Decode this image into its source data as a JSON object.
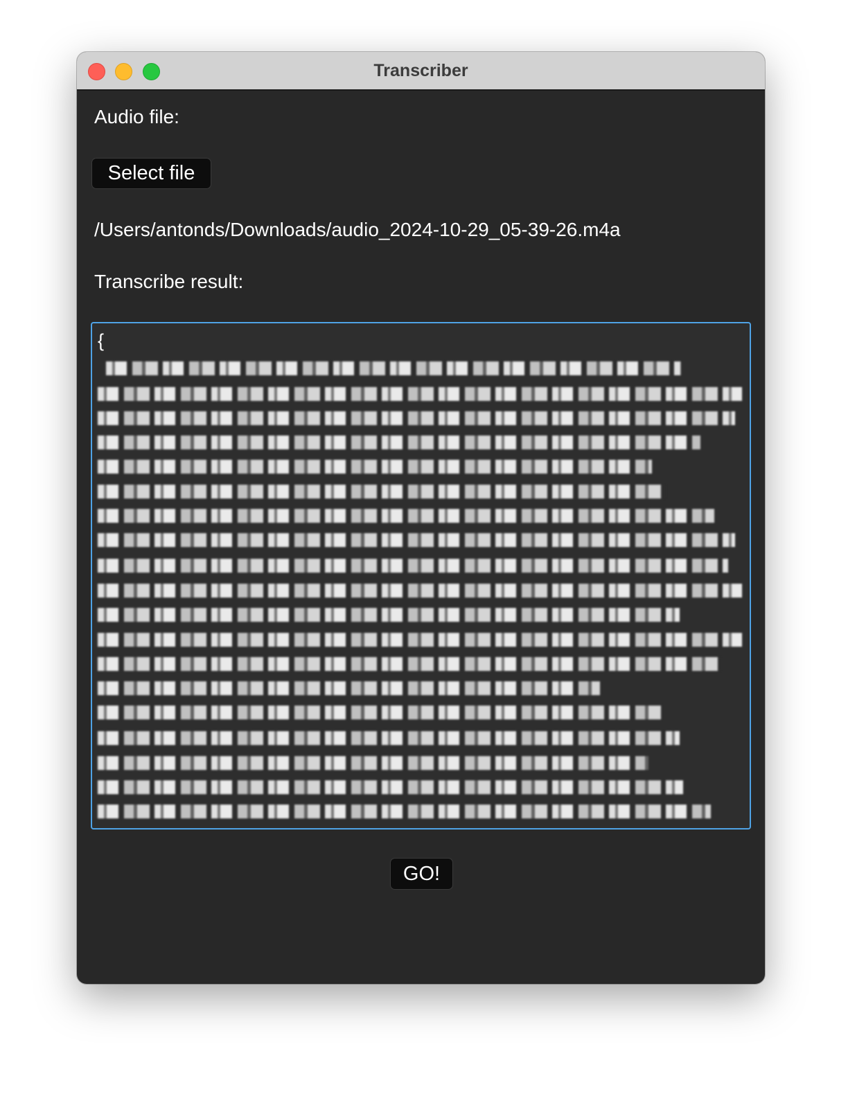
{
  "window": {
    "title": "Transcriber"
  },
  "form": {
    "audio_label": "Audio file:",
    "select_button": "Select file",
    "file_path": "/Users/antonds/Downloads/audio_2024-10-29_05-39-26.m4a",
    "result_label": "Transcribe result:",
    "result_text_start": "{",
    "go_button": "GO!"
  },
  "colors": {
    "window_bg": "#282828",
    "titlebar_bg": "#d2d2d2",
    "textarea_border": "#4fa3e6",
    "close": "#fe5f57",
    "minimize": "#febc2e",
    "zoom": "#28c840"
  }
}
